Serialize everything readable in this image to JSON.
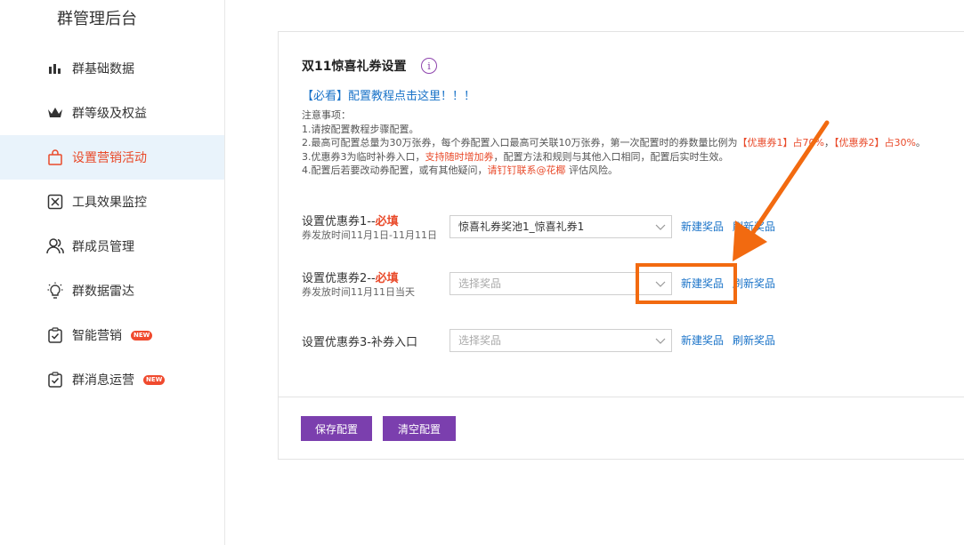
{
  "sidebar": {
    "title": "群管理后台",
    "items": [
      {
        "label": "群基础数据",
        "icon": "bar-chart-icon"
      },
      {
        "label": "群等级及权益",
        "icon": "crown-icon"
      },
      {
        "label": "设置营销活动",
        "icon": "shopping-bag-icon",
        "active": true
      },
      {
        "label": "工具效果监控",
        "icon": "monitor-tool-icon"
      },
      {
        "label": "群成员管理",
        "icon": "users-icon"
      },
      {
        "label": "群数据雷达",
        "icon": "lightbulb-icon"
      },
      {
        "label": "智能营销",
        "icon": "clipboard-check-icon",
        "badge": "NEW"
      },
      {
        "label": "群消息运营",
        "icon": "clipboard-check-icon",
        "badge": "NEW"
      }
    ]
  },
  "panel": {
    "title": "双11惊喜礼券设置",
    "info_icon": "i",
    "tutorial_link": "【必看】配置教程点击这里！！！",
    "notes": {
      "heading": "注意事项：",
      "line1": "1.请按配置教程步骤配置。",
      "line2_a": "2.最高可配置总量为30万张券，每个券配置入口最高可关联10万张券，第一次配置时的券数量比例为",
      "line2_b": "【优惠券1】占70%",
      "line2_c": "，",
      "line2_d": "【优惠券2】占30%",
      "line2_e": "。",
      "line3_a": "3.优惠券3为临时补券入口，",
      "line3_b": "支持随时增加券",
      "line3_c": "，配置方法和规则与其他入口相同，配置后实时生效。",
      "line4_a": "4.配置后若要改动券配置，或有其他疑问，",
      "line4_b": "请钉钉联系@花椰",
      "line4_c": " 评估风险。"
    },
    "coupon1": {
      "label": "设置优惠券1--",
      "required": "必填",
      "sub": "券发放时间11月1日-11月11日",
      "value": "惊喜礼券奖池1_惊喜礼券1"
    },
    "coupon2": {
      "label": "设置优惠券2--",
      "required": "必填",
      "sub": "券发放时间11月11日当天",
      "placeholder": "选择奖品"
    },
    "coupon3": {
      "label": "设置优惠券3-补券入口",
      "placeholder": "选择奖品"
    },
    "new_prize": "新建奖品",
    "refresh_prize": "刷新奖品",
    "save_button": "保存配置",
    "clear_button": "清空配置"
  },
  "colors": {
    "accent_purple": "#7b3fae",
    "link_blue": "#1a73c8",
    "warning_red": "#e94a2a",
    "annotation_orange": "#f26a10",
    "active_bg": "#e9f3fb"
  }
}
